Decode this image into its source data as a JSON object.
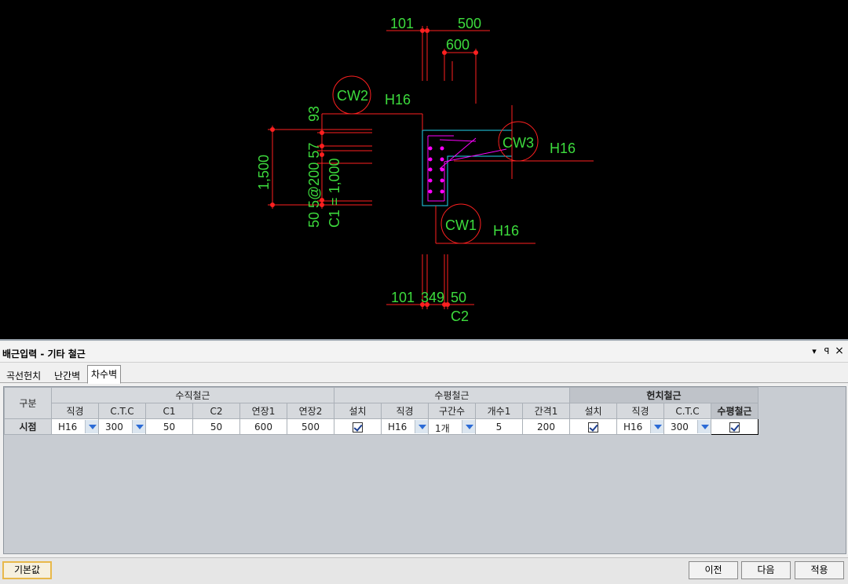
{
  "drawing": {
    "labels": {
      "top_dim_a": "101",
      "top_dim_b": "500",
      "top_dim_c": "600",
      "cw2": "CW2",
      "cw3": "CW3",
      "cw1": "CW1",
      "h16_a": "H16",
      "h16_b": "H16",
      "h16_c": "H16",
      "left_dim": "1,500",
      "vert_93": "93",
      "vert_spacing": "50 5@200 57",
      "vert_c1": "C1 = 1,000",
      "bottom_dim_a": "101",
      "bottom_dim_b": "349",
      "bottom_dim_c": "50",
      "bottom_c2": "C2"
    },
    "colors": {
      "background": "#000000",
      "dimension": "#ff2020",
      "text": "#3ddc3d",
      "wall": "#22d3ee",
      "rebar": "#ff00ff"
    }
  },
  "panel": {
    "title": "배근입력 - 기타 철근",
    "controls": {
      "dropdown": "▾",
      "pin": "ꟼ",
      "close": "×"
    },
    "tabs": [
      {
        "label": "곡선헌치",
        "active": false
      },
      {
        "label": "난간벽",
        "active": false
      },
      {
        "label": "차수벽",
        "active": true
      }
    ],
    "table": {
      "corner_header": "구분",
      "group_headers": {
        "vertical": "수직철근",
        "horizontal": "수평철근",
        "haunch": "헌치철근"
      },
      "columns": {
        "v_dia": "직경",
        "v_ctc": "C.T.C",
        "v_c1": "C1",
        "v_c2": "C2",
        "v_ext1": "연장1",
        "v_ext2": "연장2",
        "h_install": "설치",
        "h_dia": "직경",
        "h_sections": "구간수",
        "h_count1": "개수1",
        "h_gap1": "간격1",
        "k_install": "설치",
        "k_dia": "직경",
        "k_ctc": "C.T.C",
        "k_horiz": "수평철근"
      },
      "row": {
        "label": "시점",
        "v_dia": "H16",
        "v_ctc": "300",
        "v_c1": "50",
        "v_c2": "50",
        "v_ext1": "600",
        "v_ext2": "500",
        "h_install": true,
        "h_dia": "H16",
        "h_sections": "1개",
        "h_count1": "5",
        "h_gap1": "200",
        "k_install": true,
        "k_dia": "H16",
        "k_ctc": "300",
        "k_horiz": true
      }
    },
    "buttons": {
      "default": "기본값",
      "prev": "이전",
      "next": "다음",
      "apply": "적용"
    }
  }
}
